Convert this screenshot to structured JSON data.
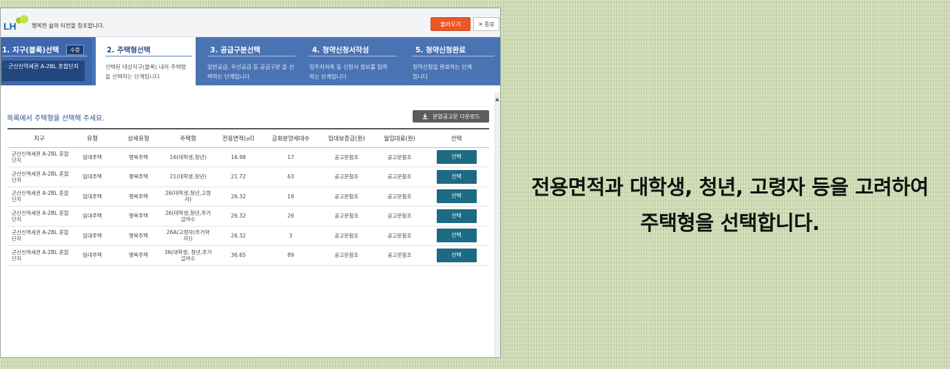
{
  "header": {
    "logo_text": "LH",
    "slogan": "행복한 삶의 터전을 창조합니다.",
    "load_button": "불러오기",
    "close_button": "종료",
    "close_glyph": "✕"
  },
  "steps": [
    {
      "title": "1. 지구(블록)선택",
      "badge": "수정",
      "selected": "· 군산신역세권 A-2BL 혼합단지"
    },
    {
      "title": "2. 주택형선택",
      "desc": "선택된 대상지구(블록) 내의 주택형을 선택하는 단계입니다"
    },
    {
      "title": "3. 공급구분선택",
      "desc": "일반공급, 우선공급 등 공급구분 을 선택하는 단계입니다"
    },
    {
      "title": "4. 청약신청서작성",
      "desc": "입주자저축 등 신청서 정보를 입력하는 단계입니다"
    },
    {
      "title": "5. 청약신청완료",
      "desc": "청약신청을 완료하는 단계입니다"
    }
  ],
  "main": {
    "instruction": "목록에서 주택형을 선택해 주세요.",
    "download_button": "분양공고문 다운로드"
  },
  "table": {
    "headers": [
      "지구",
      "유형",
      "상세유형",
      "주택형",
      "전용면적(㎡)",
      "금회분양세대수",
      "임대보증금(원)",
      "월임대료(원)",
      "선택"
    ],
    "rows": [
      {
        "district": "군산신역세권 A-2BL 혼합단지",
        "type": "임대주택",
        "detail": "행복주택",
        "housing": "16(대학생,청년)",
        "area": "16.98",
        "units": "17",
        "deposit": "공고문참조",
        "rent": "공고문참조",
        "select": "선택"
      },
      {
        "district": "군산신역세권 A-2BL 혼합단지",
        "type": "임대주택",
        "detail": "행복주택",
        "housing": "21(대학생,청년)",
        "area": "21.72",
        "units": "63",
        "deposit": "공고문참조",
        "rent": "공고문참조",
        "select": "선택"
      },
      {
        "district": "군산신역세권 A-2BL 혼합단지",
        "type": "임대주택",
        "detail": "행복주택",
        "housing": "26(대학생,청년,고령자)",
        "area": "26.32",
        "units": "19",
        "deposit": "공고문참조",
        "rent": "공고문참조",
        "select": "선택"
      },
      {
        "district": "군산신역세권 A-2BL 혼합단지",
        "type": "임대주택",
        "detail": "행복주택",
        "housing": "26(대학생,청년,주거급여수",
        "area": "26.32",
        "units": "26",
        "deposit": "공고문참조",
        "rent": "공고문참조",
        "select": "선택"
      },
      {
        "district": "군산신역세권 A-2BL 혼합단지",
        "type": "임대주택",
        "detail": "행복주택",
        "housing": "26A(고령자(주거약자))",
        "area": "26.32",
        "units": "3",
        "deposit": "공고문참조",
        "rent": "공고문참조",
        "select": "선택"
      },
      {
        "district": "군산신역세권 A-2BL 혼합단지",
        "type": "임대주택",
        "detail": "행복주택",
        "housing": "36(대학생, 청년,주거급여수",
        "area": "36.65",
        "units": "89",
        "deposit": "공고문참조",
        "rent": "공고문참조",
        "select": "선택"
      }
    ]
  },
  "caption": {
    "line1": "전용면적과 대학생, 청년, 고령자 등을 고려하여",
    "line2": "주택형을 선택합니다."
  },
  "colors": {
    "step_bar": "#4a73b4",
    "load_button": "#e9582a",
    "select_button": "#1d6a84",
    "background": "#cfdcb2"
  }
}
